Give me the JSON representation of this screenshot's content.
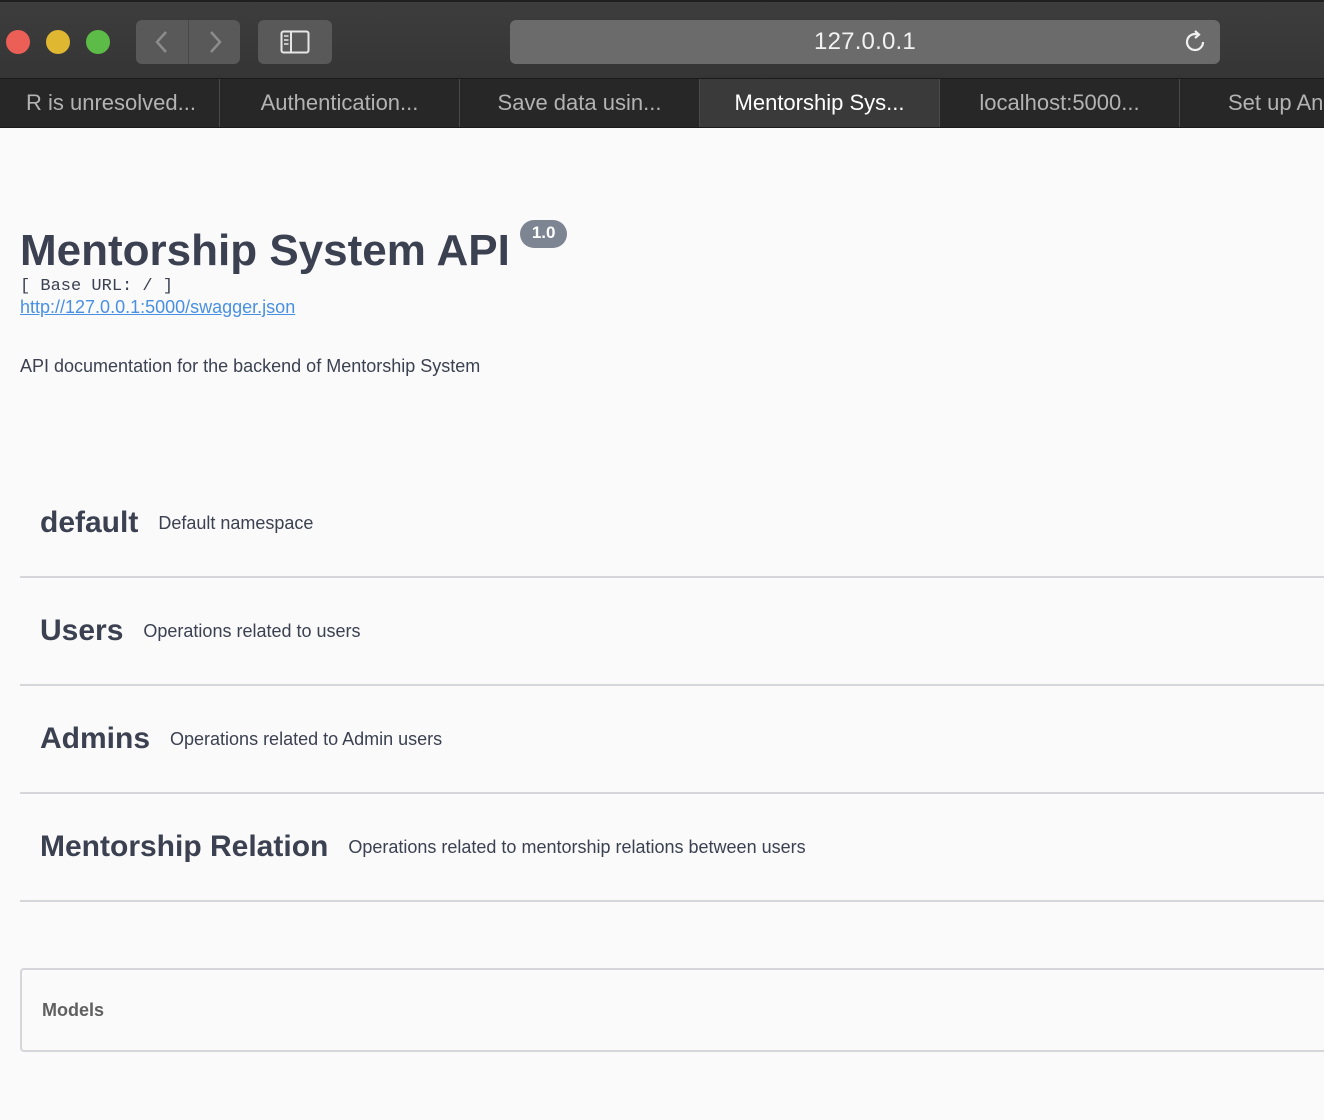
{
  "browser": {
    "address": "127.0.0.1",
    "tabs": [
      {
        "label": "R is unresolved..."
      },
      {
        "label": "Authentication..."
      },
      {
        "label": "Save data usin..."
      },
      {
        "label": "Mentorship Sys..."
      },
      {
        "label": "localhost:5000..."
      },
      {
        "label": "Set up An"
      }
    ]
  },
  "api": {
    "title": "Mentorship System API",
    "version": "1.0",
    "base_url": "[ Base URL: / ]",
    "spec_link": "http://127.0.0.1:5000/swagger.json",
    "description": "API documentation for the backend of Mentorship System"
  },
  "sections": [
    {
      "name": "default",
      "description": "Default namespace"
    },
    {
      "name": "Users",
      "description": "Operations related to users"
    },
    {
      "name": "Admins",
      "description": "Operations related to Admin users"
    },
    {
      "name": "Mentorship Relation",
      "description": "Operations related to mentorship relations between users"
    }
  ],
  "models": {
    "label": "Models"
  }
}
